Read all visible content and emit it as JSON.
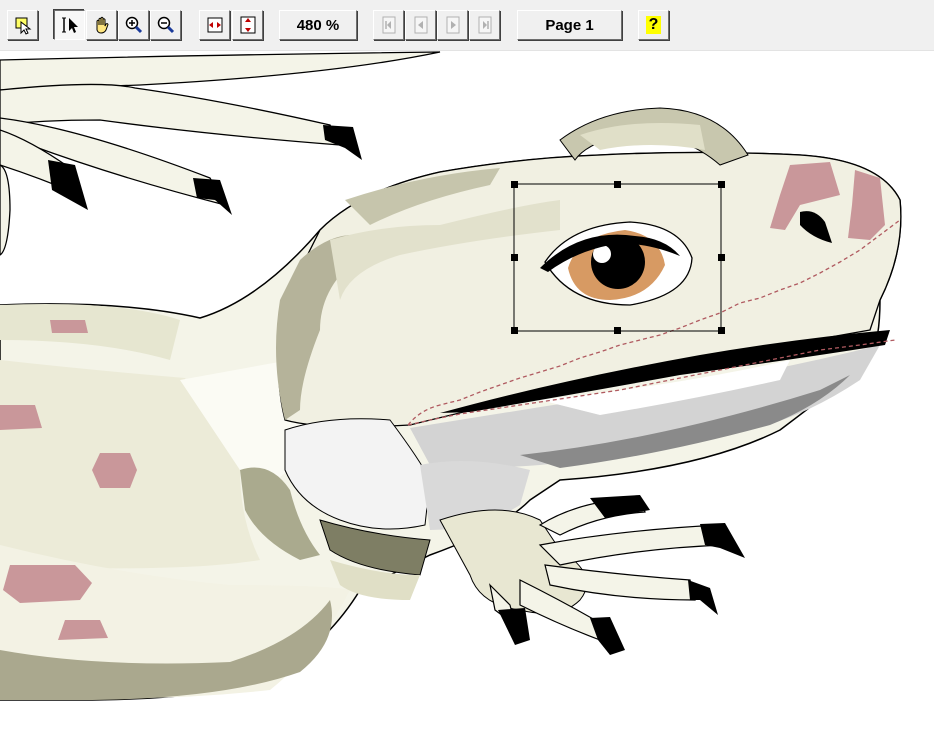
{
  "toolbar": {
    "zoom_label": "480 %",
    "page_label": "Page 1",
    "help_label": "?",
    "buttons": [
      {
        "name": "select-object-icon"
      },
      {
        "name": "pointer-tool-icon",
        "pressed": true
      },
      {
        "name": "hand-tool-icon"
      },
      {
        "name": "zoom-in-icon"
      },
      {
        "name": "zoom-out-icon"
      },
      {
        "name": "fit-width-icon"
      },
      {
        "name": "fit-height-icon"
      },
      {
        "name": "first-page-icon",
        "disabled": true
      },
      {
        "name": "previous-page-icon",
        "disabled": true
      },
      {
        "name": "next-page-icon",
        "disabled": true
      },
      {
        "name": "last-page-icon",
        "disabled": true
      }
    ]
  },
  "canvas": {
    "content": "lizard-clipart",
    "colors": {
      "skin_light": "#f4f4e8",
      "skin_shade": "#dcdcc4",
      "skin_dark": "#aaaa8e",
      "skin_darker": "#7e7e64",
      "spots": "#c9979a",
      "claw": "#000000",
      "iris": "#d79a63",
      "mouth_outline": "#b05a60"
    }
  }
}
